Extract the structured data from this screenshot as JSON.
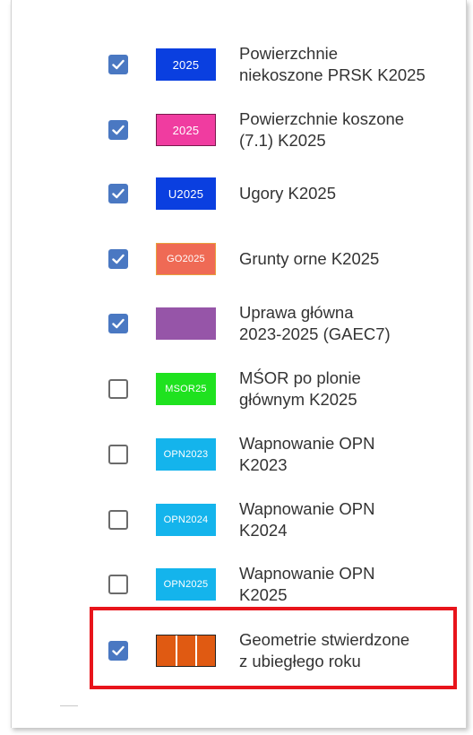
{
  "layers": [
    {
      "swatch_text": "2025",
      "color": "#0a3fe0",
      "border": "#0a3fe0",
      "checked": true,
      "label_lines": [
        "Powierzchnie",
        "niekoszone PRSK K2025"
      ],
      "swatch_name": "swatch-prsk-niekoszone"
    },
    {
      "swatch_text": "2025",
      "color": "#f03ca0",
      "border": "#7a1a4e",
      "checked": true,
      "label_lines": [
        "Powierzchnie koszone",
        "(7.1) K2025"
      ],
      "swatch_name": "swatch-koszone"
    },
    {
      "swatch_text": "U2025",
      "color": "#0a3fe0",
      "border": "#0a3fe0",
      "checked": true,
      "label_lines": [
        "Ugory K2025"
      ],
      "swatch_name": "swatch-ugory"
    },
    {
      "swatch_text": "GO2025",
      "color": "#ef6a55",
      "border": "#e8a03c",
      "checked": true,
      "label_lines": [
        "Grunty orne K2025"
      ],
      "swatch_name": "swatch-grunty-orne"
    },
    {
      "swatch_text": "",
      "color": "#9655a8",
      "border": "#9655a8",
      "checked": true,
      "label_lines": [
        "Uprawa główna",
        "2023-2025 (GAEC7)"
      ],
      "swatch_name": "swatch-uprawa-glowna"
    },
    {
      "swatch_text": "MSOR25",
      "color": "#1fe21f",
      "border": "#1fe21f",
      "checked": false,
      "label_lines": [
        "MŚOR po plonie",
        "głównym K2025"
      ],
      "swatch_name": "swatch-msor"
    },
    {
      "swatch_text": "OPN2023",
      "color": "#14b4ec",
      "border": "#14b4ec",
      "checked": false,
      "label_lines": [
        "Wapnowanie OPN",
        "K2023"
      ],
      "swatch_name": "swatch-opn2023"
    },
    {
      "swatch_text": "OPN2024",
      "color": "#14b4ec",
      "border": "#14b4ec",
      "checked": false,
      "label_lines": [
        "Wapnowanie OPN",
        "K2024"
      ],
      "swatch_name": "swatch-opn2024"
    },
    {
      "swatch_text": "OPN2025",
      "color": "#14b4ec",
      "border": "#14b4ec",
      "checked": false,
      "label_lines": [
        "Wapnowanie OPN",
        "K2025"
      ],
      "swatch_name": "swatch-opn2025"
    },
    {
      "swatch_text": "",
      "color": "#e05a12",
      "border": "#222222",
      "checked": true,
      "label_lines": [
        "Geometrie stwierdzone",
        "z ubiegłego roku"
      ],
      "swatch_name": "swatch-geometrie",
      "pattern": "vertical-white-lines"
    }
  ],
  "highlight_color": "#e8141b",
  "checkbox_color": "#4a78c2"
}
